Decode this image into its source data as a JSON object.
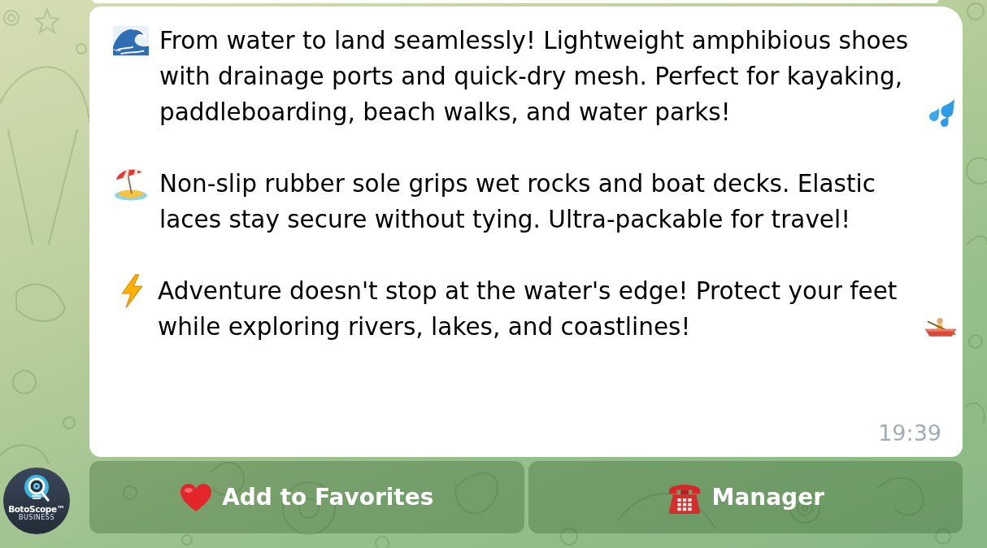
{
  "bot": {
    "name": "BotoScope™",
    "tagline": "BUSINESS"
  },
  "message": {
    "paragraphs": [
      "From water to land seamlessly! Lightweight amphibious shoes with drainage ports and quick-dry mesh. Perfect for kayaking, paddleboarding, beach walks, and water parks!",
      "Non-slip rubber sole grips wet rocks and boat decks. Elastic laces stay secure without tying. Ultra-packable for travel!",
      "Adventure doesn't stop at the water's edge! Protect your feet while exploring rivers, lakes, and coastlines!"
    ],
    "time": "19:39"
  },
  "buttons": [
    {
      "label": "Add to Favorites"
    },
    {
      "label": "Manager"
    }
  ]
}
